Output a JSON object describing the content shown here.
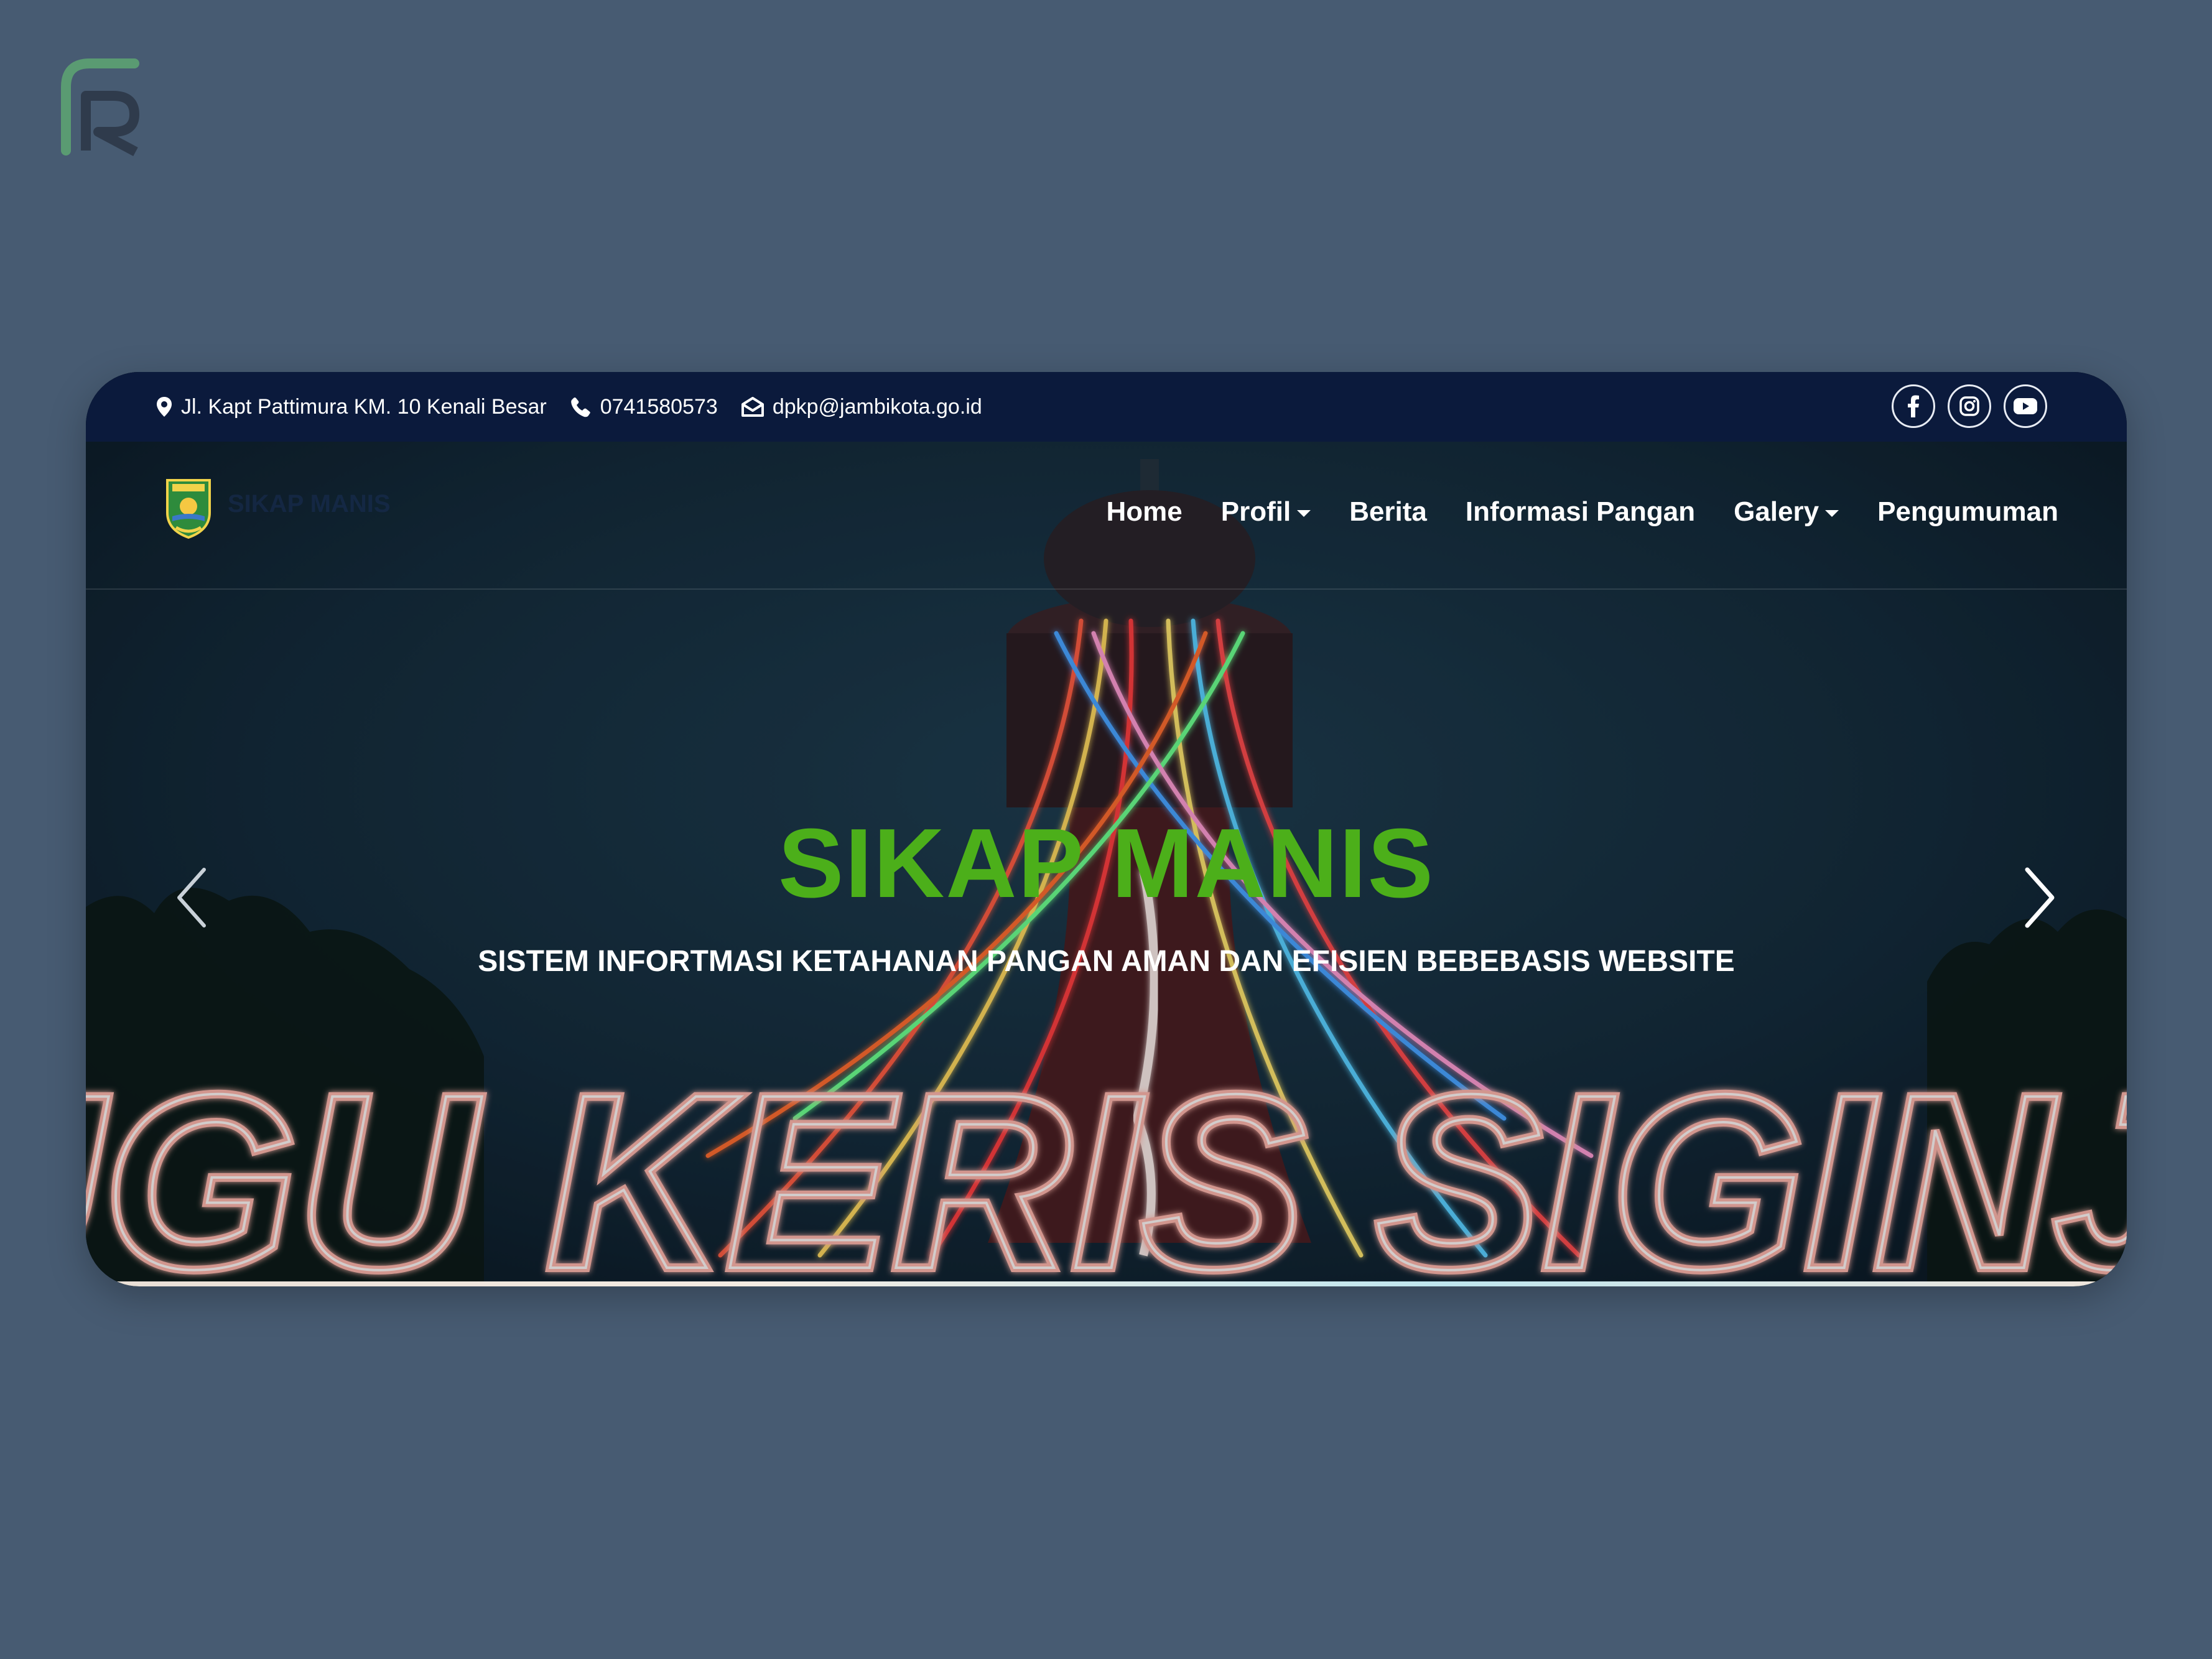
{
  "brand": {
    "icon": "fr-monogram-logo",
    "colors": {
      "green": "#5a9b72",
      "dark": "#2f3b4c",
      "background": "#475b72"
    }
  },
  "topbar": {
    "address": "Jl. Kapt Pattimura KM. 10 Kenali Besar",
    "phone": "0741580573",
    "email": "dpkp@jambikota.go.id",
    "social": [
      {
        "name": "facebook",
        "icon": "facebook-icon"
      },
      {
        "name": "instagram",
        "icon": "instagram-icon"
      },
      {
        "name": "youtube",
        "icon": "youtube-icon"
      }
    ]
  },
  "navbar": {
    "logo_text": "SIKAP MANIS",
    "menu": [
      {
        "label": "Home",
        "dropdown": false
      },
      {
        "label": "Profil",
        "dropdown": true
      },
      {
        "label": "Berita",
        "dropdown": false
      },
      {
        "label": "Informasi Pangan",
        "dropdown": false
      },
      {
        "label": "Galery",
        "dropdown": true
      },
      {
        "label": "Pengumuman",
        "dropdown": false
      }
    ]
  },
  "hero": {
    "title": "SIKAP MANIS",
    "subtitle": "SISTEM INFORTMASI KETAHANAN PANGAN AMAN DAN EFISIEN BEBEBASIS WEBSITE",
    "background_text": "TUGU KERIS SIGINJAI",
    "title_color": "#4caf1a"
  }
}
